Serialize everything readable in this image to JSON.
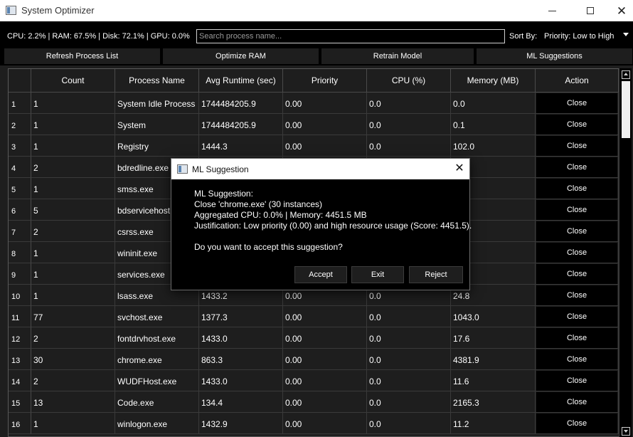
{
  "window": {
    "title": "System Optimizer"
  },
  "stats": {
    "text": "CPU: 2.2% | RAM: 67.5% | Disk: 72.1% | GPU: 0.0%"
  },
  "search": {
    "placeholder": "Search process name...",
    "value": ""
  },
  "sort": {
    "label": "Sort By:",
    "selected": "Priority: Low to High"
  },
  "actions": {
    "refresh": "Refresh Process List",
    "optimize": "Optimize RAM",
    "retrain": "Retrain Model",
    "ml": "ML Suggestions"
  },
  "table": {
    "headers": [
      "Count",
      "Process Name",
      "Avg Runtime (sec)",
      "Priority",
      "CPU (%)",
      "Memory (MB)",
      "Action"
    ],
    "rows": [
      {
        "idx": "1",
        "count": "1",
        "name": "System Idle Process",
        "runtime": "1744484205.9",
        "priority": "0.00",
        "cpu": "0.0",
        "memory": "0.0",
        "action": "Close"
      },
      {
        "idx": "2",
        "count": "1",
        "name": "System",
        "runtime": "1744484205.9",
        "priority": "0.00",
        "cpu": "0.0",
        "memory": "0.1",
        "action": "Close"
      },
      {
        "idx": "3",
        "count": "1",
        "name": "Registry",
        "runtime": "1444.3",
        "priority": "0.00",
        "cpu": "0.0",
        "memory": "102.0",
        "action": "Close"
      },
      {
        "idx": "4",
        "count": "2",
        "name": "bdredline.exe",
        "runtime": "",
        "priority": "",
        "cpu": "",
        "memory": "",
        "action": "Close"
      },
      {
        "idx": "5",
        "count": "1",
        "name": "smss.exe",
        "runtime": "",
        "priority": "",
        "cpu": "",
        "memory": "",
        "action": "Close"
      },
      {
        "idx": "6",
        "count": "5",
        "name": "bdservicehost",
        "runtime": "",
        "priority": "",
        "cpu": "",
        "memory": "3",
        "action": "Close"
      },
      {
        "idx": "7",
        "count": "2",
        "name": "csrss.exe",
        "runtime": "",
        "priority": "",
        "cpu": "",
        "memory": "",
        "action": "Close"
      },
      {
        "idx": "8",
        "count": "1",
        "name": "wininit.exe",
        "runtime": "",
        "priority": "",
        "cpu": "",
        "memory": "",
        "action": "Close"
      },
      {
        "idx": "9",
        "count": "1",
        "name": "services.exe",
        "runtime": "",
        "priority": "",
        "cpu": "",
        "memory": "",
        "action": "Close"
      },
      {
        "idx": "10",
        "count": "1",
        "name": "lsass.exe",
        "runtime": "1433.2",
        "priority": "0.00",
        "cpu": "0.0",
        "memory": "24.8",
        "action": "Close"
      },
      {
        "idx": "11",
        "count": "77",
        "name": "svchost.exe",
        "runtime": "1377.3",
        "priority": "0.00",
        "cpu": "0.0",
        "memory": "1043.0",
        "action": "Close"
      },
      {
        "idx": "12",
        "count": "2",
        "name": "fontdrvhost.exe",
        "runtime": "1433.0",
        "priority": "0.00",
        "cpu": "0.0",
        "memory": "17.6",
        "action": "Close"
      },
      {
        "idx": "13",
        "count": "30",
        "name": "chrome.exe",
        "runtime": "863.3",
        "priority": "0.00",
        "cpu": "0.0",
        "memory": "4381.9",
        "action": "Close"
      },
      {
        "idx": "14",
        "count": "2",
        "name": "WUDFHost.exe",
        "runtime": "1433.0",
        "priority": "0.00",
        "cpu": "0.0",
        "memory": "11.6",
        "action": "Close"
      },
      {
        "idx": "15",
        "count": "13",
        "name": "Code.exe",
        "runtime": "134.4",
        "priority": "0.00",
        "cpu": "0.0",
        "memory": "2165.3",
        "action": "Close"
      },
      {
        "idx": "16",
        "count": "1",
        "name": "winlogon.exe",
        "runtime": "1432.9",
        "priority": "0.00",
        "cpu": "0.0",
        "memory": "11.2",
        "action": "Close"
      }
    ]
  },
  "dialog": {
    "title": "ML Suggestion",
    "lines": [
      "ML Suggestion:",
      "Close 'chrome.exe' (30 instances)",
      "Aggregated CPU: 0.0% | Memory: 4451.5 MB",
      "Justification: Low priority (0.00) and high resource usage (Score: 4451.5)."
    ],
    "question": "Do you want to accept this suggestion?",
    "accept": "Accept",
    "exit": "Exit",
    "reject": "Reject"
  }
}
